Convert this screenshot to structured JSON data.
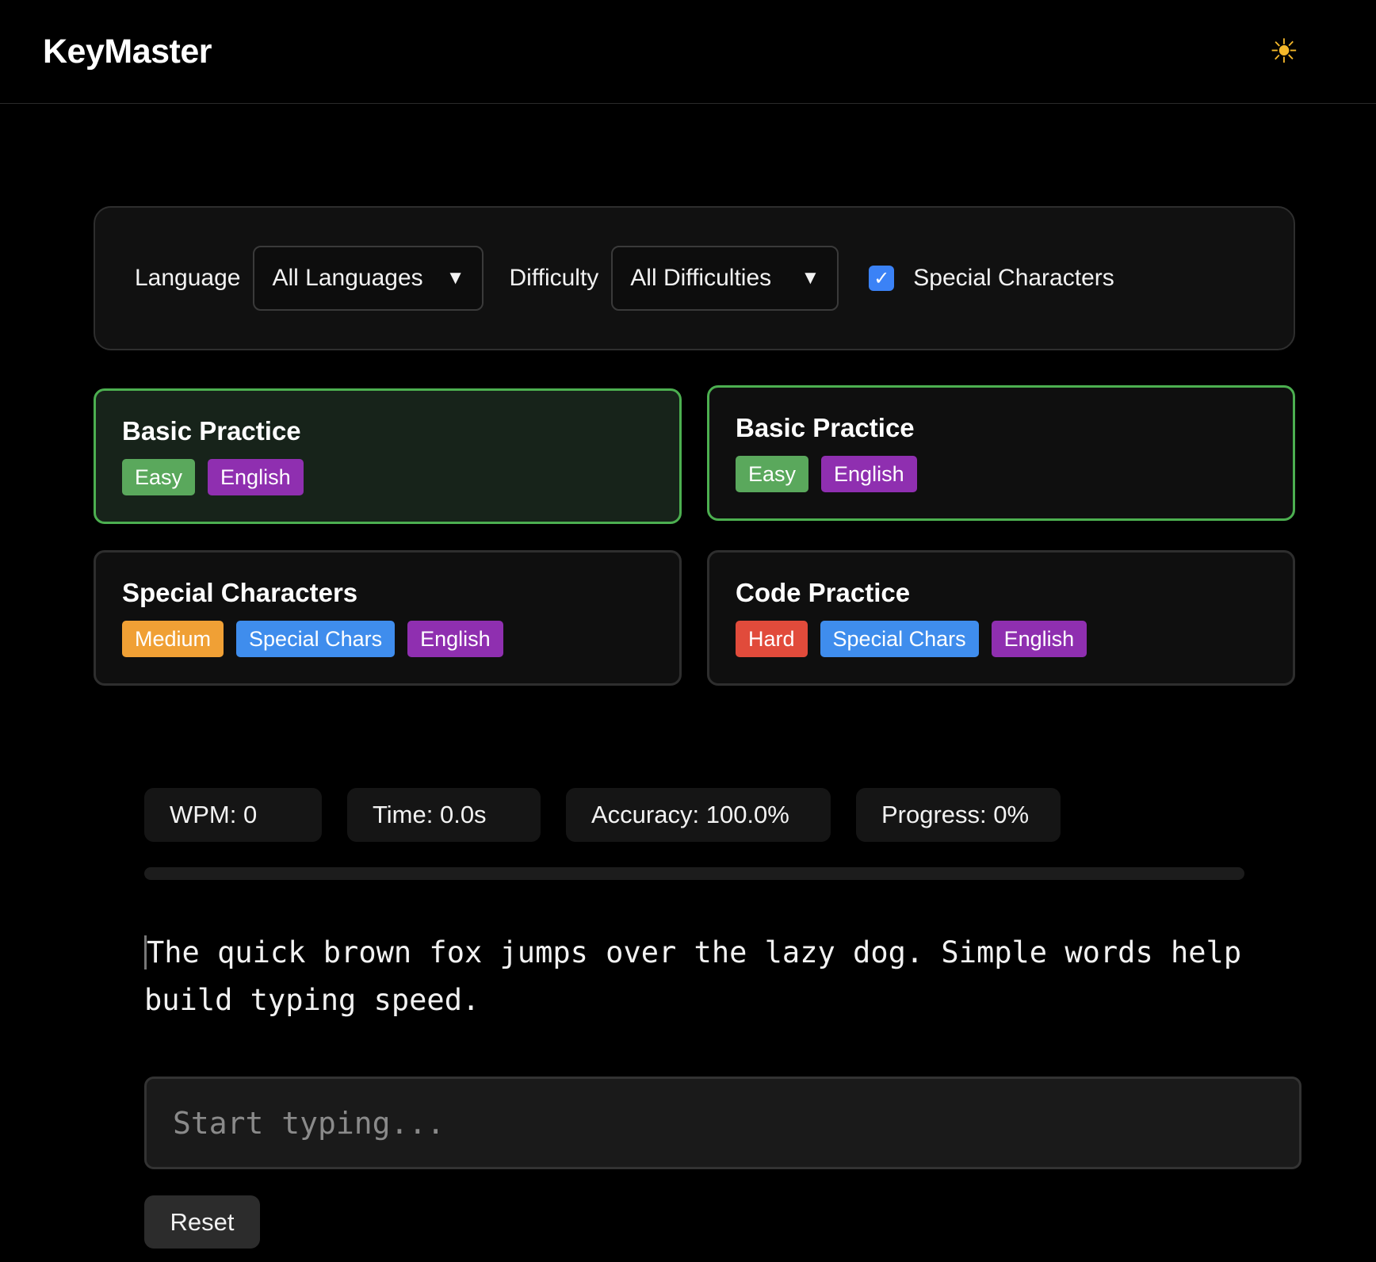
{
  "header": {
    "title": "KeyMaster",
    "theme_icon": "☀"
  },
  "filters": {
    "language_label": "Language",
    "language_value": "All Languages",
    "difficulty_label": "Difficulty",
    "difficulty_value": "All Difficulties",
    "special_label": "Special Characters",
    "special_checked": true,
    "dropdown_icon": "▼",
    "check_icon": "✓"
  },
  "cards": [
    {
      "title": "Basic Practice",
      "badges": [
        "Easy",
        "English"
      ]
    },
    {
      "title": "Basic Practice",
      "badges": [
        "Easy",
        "English"
      ]
    },
    {
      "title": "Special Characters",
      "badges": [
        "Medium",
        "Special Chars",
        "English"
      ]
    },
    {
      "title": "Code Practice",
      "badges": [
        "Hard",
        "Special Chars",
        "English"
      ]
    }
  ],
  "stats": {
    "wpm": "WPM: 0",
    "time": "Time: 0.0s",
    "accuracy": "Accuracy: 100.0%",
    "progress": "Progress: 0%",
    "progress_value": 0
  },
  "practice": {
    "first_char": "T",
    "text_rest": "he quick brown fox jumps over the lazy dog. Simple words help build typing speed.",
    "input_placeholder": "Start typing...",
    "input_value": "",
    "reset_label": "Reset"
  },
  "colors": {
    "easy": "#5aa85c",
    "medium": "#f0a035",
    "hard": "#e14b3b",
    "special": "#3f8ded",
    "language": "#8f2fb0",
    "accent": "#4caf50"
  }
}
